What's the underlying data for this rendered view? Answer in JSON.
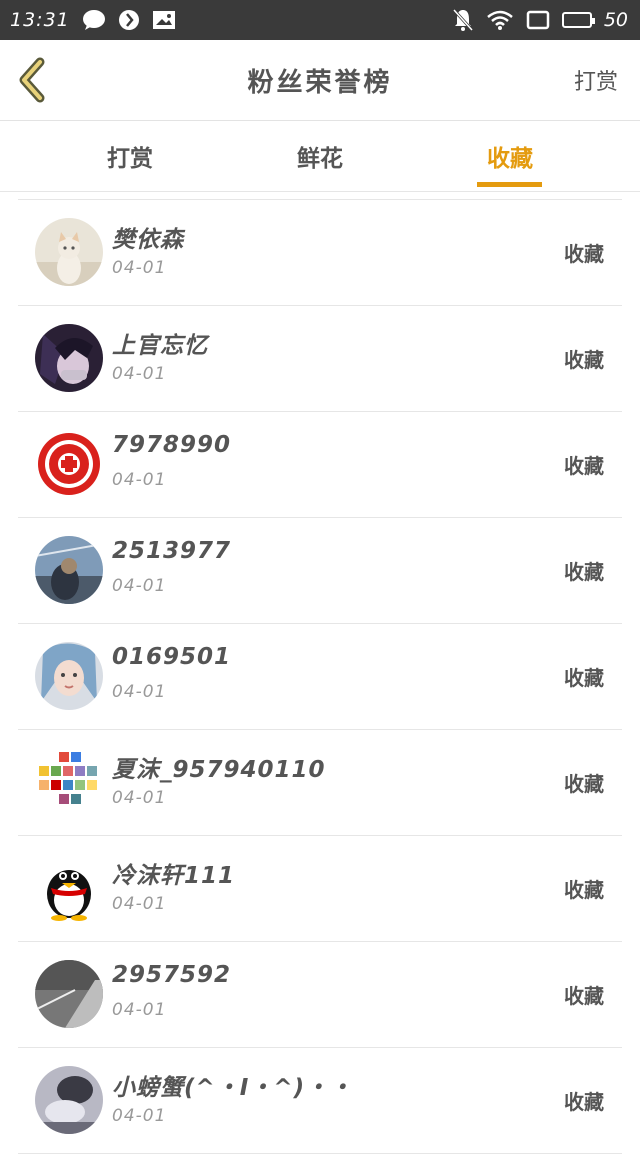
{
  "status_bar": {
    "time": "13:31",
    "battery_text": "50",
    "battery_level": 0.5,
    "icons": [
      "chat-bubble-icon",
      "app-icon",
      "image-icon",
      "mute-icon",
      "wifi-icon",
      "screen-icon",
      "battery-icon"
    ]
  },
  "header": {
    "title": "粉丝荣誉榜",
    "right_label": "打赏",
    "back_icon": "chevron-left-icon",
    "accent_color": "#e49b0f"
  },
  "tabs": [
    {
      "label": "打赏",
      "active": false
    },
    {
      "label": "鲜花",
      "active": false
    },
    {
      "label": "收藏",
      "active": true
    }
  ],
  "list": [
    {
      "name": "樊依森",
      "date": "04-01",
      "action": "收藏",
      "avatar": "cat-avatar"
    },
    {
      "name": "上官忘忆",
      "date": "04-01",
      "action": "收藏",
      "avatar": "anime-avatar"
    },
    {
      "name": "7978990",
      "date": "04-01",
      "action": "收藏",
      "avatar": "papercut-avatar"
    },
    {
      "name": "2513977",
      "date": "04-01",
      "action": "收藏",
      "avatar": "photo-avatar"
    },
    {
      "name": "0169501",
      "date": "04-01",
      "action": "收藏",
      "avatar": "girl-avatar"
    },
    {
      "name": "夏沫_957940110",
      "date": "04-01",
      "action": "收藏",
      "avatar": "collage-avatar"
    },
    {
      "name": "冷沫轩111",
      "date": "04-01",
      "action": "收藏",
      "avatar": "penguin-avatar"
    },
    {
      "name": "2957592",
      "date": "04-01",
      "action": "收藏",
      "avatar": "road-avatar"
    },
    {
      "name": "小螃蟹(^・I・^)・・",
      "date": "04-01",
      "action": "收藏",
      "avatar": "bw-avatar"
    }
  ]
}
